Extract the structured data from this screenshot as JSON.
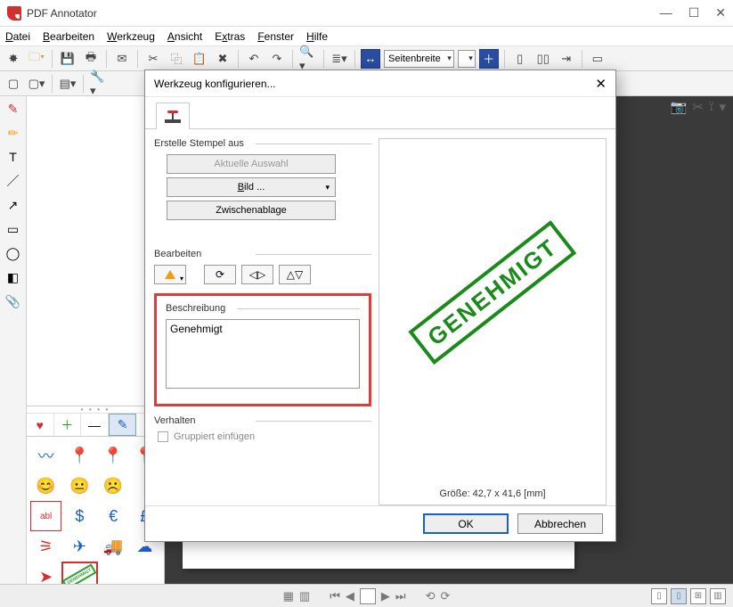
{
  "window": {
    "title": "PDF Annotator"
  },
  "menu": {
    "file": "Datei",
    "edit": "Bearbeiten",
    "tool": "Werkzeug",
    "view": "Ansicht",
    "extras": "Extras",
    "window": "Fenster",
    "help": "Hilfe"
  },
  "toolbar": {
    "zoom_mode": "Seitenbreite"
  },
  "dialog": {
    "title": "Werkzeug konfigurieren...",
    "group_create": "Erstelle Stempel aus",
    "btn_selection": "Aktuelle Auswahl",
    "btn_image": "Bild ...",
    "btn_clipboard": "Zwischenablage",
    "group_edit": "Bearbeiten",
    "group_desc": "Beschreibung",
    "desc_value": "Genehmigt",
    "group_behavior": "Verhalten",
    "chk_grouped": "Gruppiert einfügen",
    "preview_text": "GENEHMIGT",
    "size_label": "Größe: 42,7 x 41,6 [mm]",
    "ok": "OK",
    "cancel": "Abbrechen"
  },
  "page_stamp": "GENEHMIGT"
}
